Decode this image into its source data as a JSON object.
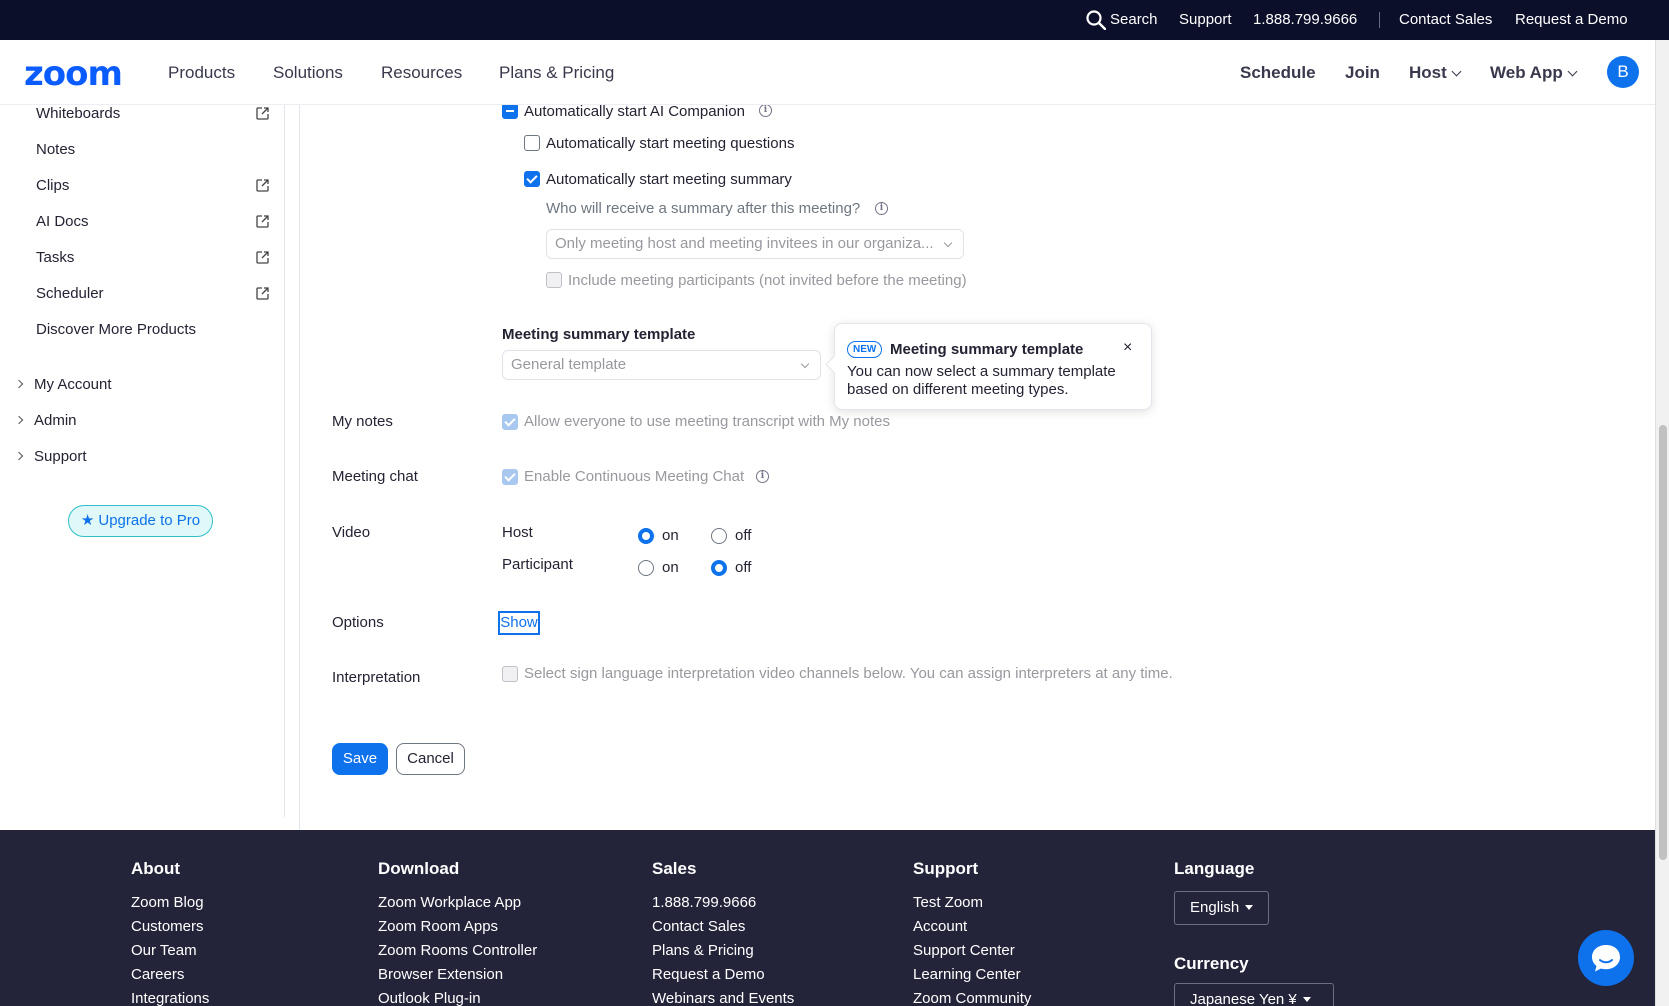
{
  "topbar": {
    "search": "Search",
    "support": "Support",
    "phone": "1.888.799.9666",
    "contact_sales": "Contact Sales",
    "request_demo": "Request a Demo"
  },
  "nav": {
    "logo": "zoom",
    "products": "Products",
    "solutions": "Solutions",
    "resources": "Resources",
    "plans_pricing": "Plans & Pricing",
    "schedule": "Schedule",
    "join": "Join",
    "host": "Host",
    "web_app": "Web App",
    "avatar_initial": "B"
  },
  "sidebar": {
    "items": [
      {
        "label": "Whiteboards"
      },
      {
        "label": "Notes"
      },
      {
        "label": "Clips"
      },
      {
        "label": "AI Docs"
      },
      {
        "label": "Tasks"
      },
      {
        "label": "Scheduler"
      },
      {
        "label": "Discover More Products"
      }
    ],
    "groups": [
      {
        "label": "My Account"
      },
      {
        "label": "Admin"
      },
      {
        "label": "Support"
      }
    ],
    "upgrade": "Upgrade to Pro"
  },
  "settings": {
    "ai_companion": "Automatically start AI Companion",
    "meeting_questions": "Automatically start meeting questions",
    "meeting_summary": "Automatically start meeting summary",
    "summary_recipient_question": "Who will receive a summary after this meeting?",
    "summary_recipient_value": "Only meeting host and meeting invitees in our organiza...",
    "include_participants": "Include meeting participants (not invited before the meeting)",
    "template_heading": "Meeting summary template",
    "template_value": "General template",
    "tooltip": {
      "badge": "NEW",
      "title": "Meeting summary template",
      "close": "×",
      "body": "You can now select a summary template based on different meeting types."
    },
    "my_notes_label": "My notes",
    "my_notes_value": "Allow everyone to use meeting transcript with My notes",
    "meeting_chat_label": "Meeting chat",
    "meeting_chat_value": "Enable Continuous Meeting Chat",
    "video_label": "Video",
    "host_label": "Host",
    "participant_label": "Participant",
    "on": "on",
    "off": "off",
    "options_label": "Options",
    "show": "Show",
    "interpretation_label": "Interpretation",
    "interpretation_value": "Select sign language interpretation video channels below. You can assign interpreters at any time.",
    "save": "Save",
    "cancel": "Cancel"
  },
  "footer": {
    "about": {
      "heading": "About",
      "links": [
        "Zoom Blog",
        "Customers",
        "Our Team",
        "Careers",
        "Integrations"
      ]
    },
    "download": {
      "heading": "Download",
      "links": [
        "Zoom Workplace App",
        "Zoom Room Apps",
        "Zoom Rooms Controller",
        "Browser Extension",
        "Outlook Plug-in"
      ]
    },
    "sales": {
      "heading": "Sales",
      "links": [
        "1.888.799.9666",
        "Contact Sales",
        "Plans & Pricing",
        "Request a Demo",
        "Webinars and Events"
      ]
    },
    "support": {
      "heading": "Support",
      "links": [
        "Test Zoom",
        "Account",
        "Support Center",
        "Learning Center",
        "Zoom Community"
      ]
    },
    "language": {
      "heading": "Language",
      "value": "English"
    },
    "currency": {
      "heading": "Currency",
      "value": "Japanese Yen ¥"
    }
  },
  "colors": {
    "brand": "#0b5cff",
    "accent": "#0e72ed",
    "topbar": "#0b0f2a",
    "footer": "#23233a"
  }
}
